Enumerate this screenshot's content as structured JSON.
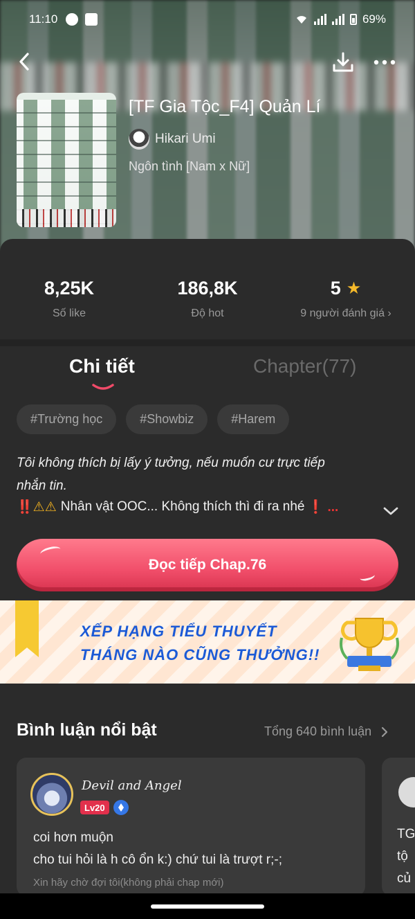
{
  "status_bar": {
    "time": "11:10",
    "battery": "69%"
  },
  "book": {
    "title": "[TF Gia Tộc_F4] Quản Lí",
    "author": "Hikari Umi",
    "genre": "Ngôn tình [Nam x Nữ]"
  },
  "stats": [
    {
      "value": "8,25K",
      "label": "Số like"
    },
    {
      "value": "186,8K",
      "label": "Độ hot"
    },
    {
      "value": "5",
      "label": "9 người đánh giá"
    }
  ],
  "tabs": {
    "detail": "Chi tiết",
    "chapter": "Chapter(77)"
  },
  "tags": [
    "#Trường học",
    "#Showbiz",
    "#Harem"
  ],
  "description": {
    "line1": "Tôi không thích bị lấy ý tưởng, nếu muốn cư trực tiếp",
    "line2": "nhắn tin.",
    "line3": "Nhân vật OOC... Không thích thì đi ra nhé",
    "warn_prefix": "‼️",
    "warn_suffix": "❗ ..."
  },
  "read_button": "Đọc tiếp Chap.76",
  "banner": {
    "line1": "XẾP HẠNG TIỂU THUYẾT",
    "line2": "THÁNG NÀO CŨNG THƯỞNG!!"
  },
  "comments_section": {
    "title": "Bình luận nổi bật",
    "total": "Tổng 640 bình luận",
    "items": [
      {
        "user": "Devil and Angel",
        "level": "Lv20",
        "line1": "coi hơn muộn",
        "line2": "cho tui hỏi là h cô ổn k:)  chứ tui là trượt r;-;",
        "chapter": "Xin hãy chờ đợi tôi(không phải chap mới)"
      }
    ],
    "peek": {
      "line1": "TG",
      "line2": "tộ",
      "line3": "củ"
    }
  }
}
